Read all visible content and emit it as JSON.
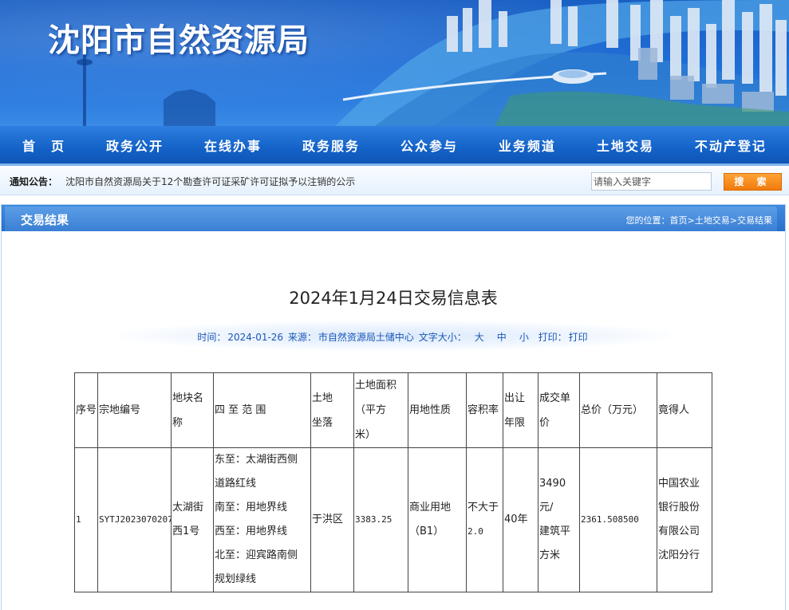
{
  "site": {
    "title": "沈阳市自然资源局"
  },
  "nav": {
    "items": [
      "首　页",
      "政务公开",
      "在线办事",
      "政务服务",
      "公众参与",
      "业务频道",
      "土地交易",
      "不动产登记"
    ]
  },
  "notice": {
    "label": "通知公告：",
    "text": "沈阳市自然资源局关于12个勘查许可证采矿许可证拟予以注销的公示"
  },
  "search": {
    "placeholder": "请输入关键字",
    "button_label": "搜 索"
  },
  "panel": {
    "title": "交易结果",
    "breadcrumb": "您的位置：首页>土地交易>交易结果"
  },
  "article": {
    "title": "2024年1月24日交易信息表",
    "meta": {
      "time_label": "时间：",
      "time_value": "2024-01-26",
      "source_label": "来源：",
      "source_value": "市自然资源局土储中心",
      "font_size_label": "文字大小：",
      "size_large": "大",
      "size_medium": "中",
      "size_small": "小",
      "print_label": "打印：",
      "print_link": "打印"
    }
  },
  "table": {
    "headers": {
      "seq": "序号",
      "code": "宗地编号",
      "name_1": "地块名",
      "name_2": "称",
      "range": "四 至 范 围",
      "loc_1": "土地",
      "loc_2": "坐落",
      "area_1": "土地面积",
      "area_2": "（平方",
      "area_3": "米）",
      "use": "用地性质",
      "far": "容积率",
      "term_1": "出让",
      "term_2": "年限",
      "price_1": "成交单",
      "price_2": "价",
      "total": "总价（万元）",
      "winner": "竟得人"
    },
    "row": {
      "seq": "1",
      "code": "SYTJ2023070207",
      "name_1": "太湖街",
      "name_2": "西1号",
      "range_1": "东至：太湖街西侧",
      "range_2": "道路红线",
      "range_3": "南至：用地界线",
      "range_4": "西至：用地界线",
      "range_5": "北至：迎宾路南侧",
      "range_6": "规划绿线",
      "loc": "于洪区",
      "area": "3383.25",
      "use_1": "商业用地",
      "use_2": "（B1）",
      "far_1": "不大于",
      "far_2": "2.0",
      "term": "40年",
      "price_1": "3490元/",
      "price_2": "建筑平",
      "price_3": "方米",
      "total": "2361.508500",
      "winner_1": "中国农业",
      "winner_2": "银行股份",
      "winner_3": "有限公司",
      "winner_4": "沈阳分行"
    }
  },
  "colors": {
    "banner_blue": "#1f6fd8",
    "nav_blue": "#1462c8",
    "search_orange": "#f07a0c",
    "meta_link": "#1a57b8"
  }
}
